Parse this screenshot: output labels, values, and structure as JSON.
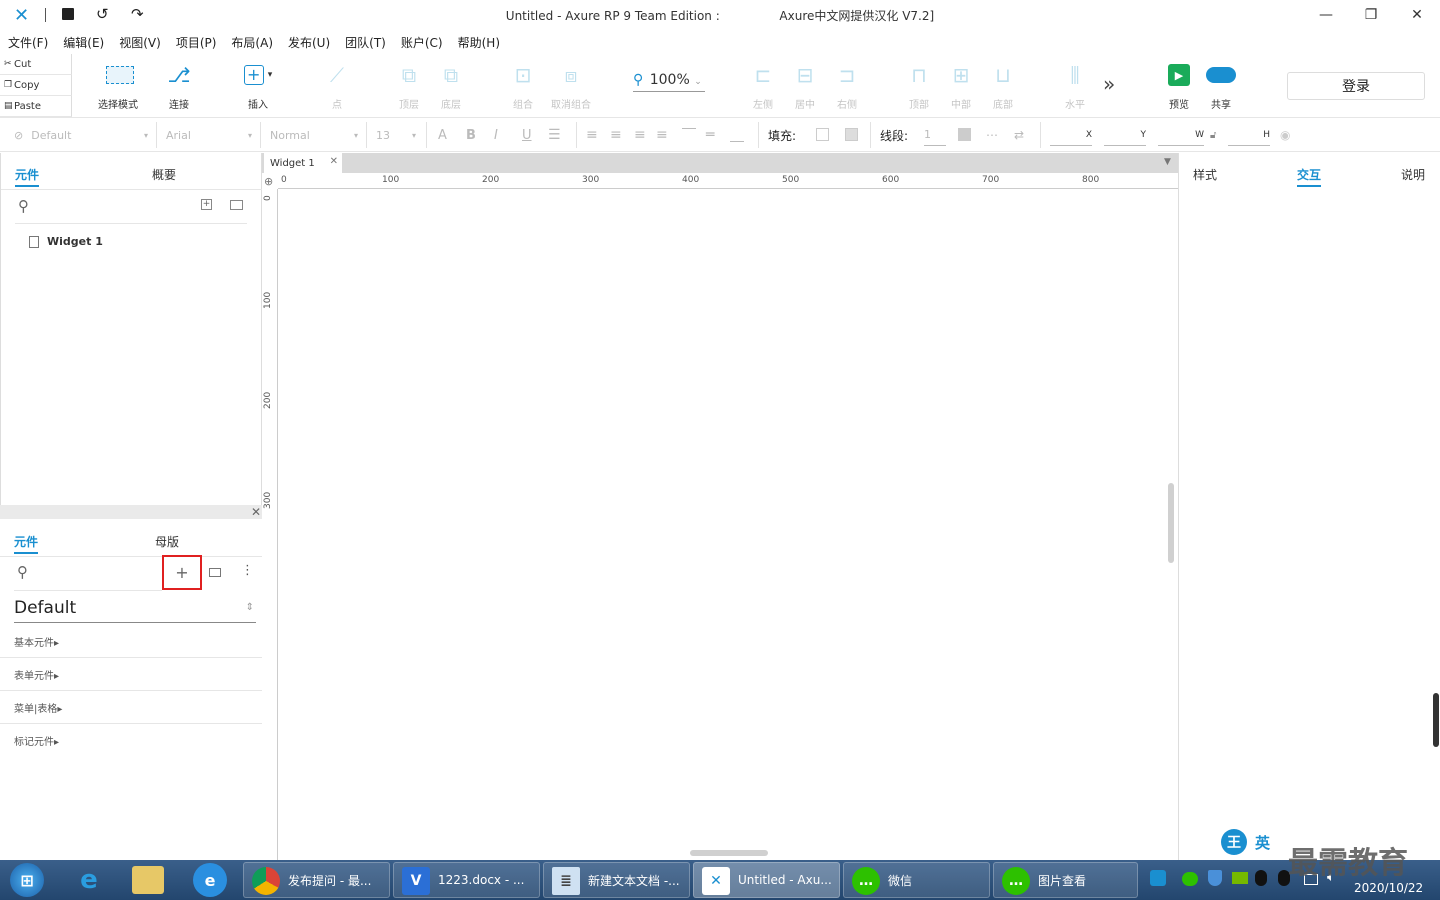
{
  "window": {
    "title_left": "Untitled - Axure RP 9 Team Edition :",
    "title_right": "Axure中文网提供汉化 V7.2]",
    "minimize": "—",
    "restore": "❐",
    "close": "✕"
  },
  "menu": [
    "文件(F)",
    "编辑(E)",
    "视图(V)",
    "项目(P)",
    "布局(A)",
    "发布(U)",
    "团队(T)",
    "账户(C)",
    "帮助(H)"
  ],
  "clipboard": {
    "cut": "Cut",
    "copy": "Copy",
    "paste": "Paste"
  },
  "toolbar": {
    "select_mode": "选择模式",
    "connect": "连接",
    "insert": "插入",
    "point": "点",
    "top_layer": "顶层",
    "bottom_layer": "底层",
    "group": "组合",
    "ungroup": "取消组合",
    "zoom": "100%",
    "align_left": "左侧",
    "align_center": "居中",
    "align_right": "右侧",
    "align_top": "顶部",
    "align_middle": "中部",
    "align_bottom": "底部",
    "distribute_h": "水平",
    "more": "»",
    "preview": "预览",
    "share": "共享",
    "login": "登录"
  },
  "format": {
    "style": "Default",
    "font": "Arial",
    "weight": "Normal",
    "size": "13",
    "fill_label": "填充:",
    "stroke_label": "线段:",
    "stroke_value": "1",
    "x_label": "X",
    "y_label": "Y",
    "w_label": "W",
    "h_label": "H"
  },
  "left_top": {
    "tab_pages": "元件",
    "tab_outline": "概要",
    "page_item": "Widget 1"
  },
  "left_bottom": {
    "tab_widgets": "元件",
    "tab_masters": "母版",
    "library": "Default",
    "sections": [
      "基本元件▸",
      "表单元件▸",
      "菜单|表格▸",
      "标记元件▸"
    ],
    "add_icon": "+"
  },
  "canvas": {
    "tab": "Widget 1",
    "h_ticks": [
      "0",
      "100",
      "200",
      "300",
      "400",
      "500",
      "600",
      "700",
      "800"
    ],
    "v_ticks": [
      "0",
      "100",
      "200",
      "300"
    ]
  },
  "right": {
    "tab_style": "样式",
    "tab_interact": "交互",
    "tab_notes": "说明"
  },
  "taskbar": {
    "items": [
      "发布提问 - 最...",
      "1223.docx - ...",
      "新建文本文档 -...",
      "Untitled - Axu...",
      "微信",
      "图片查看"
    ],
    "date": "2020/10/22",
    "ime_a": "王",
    "ime_b": "英",
    "watermark": "最需教育"
  },
  "colors": {
    "accent": "#1a8fd0",
    "highlight_box": "#e02020",
    "taskbar": "#2b4f7a"
  }
}
